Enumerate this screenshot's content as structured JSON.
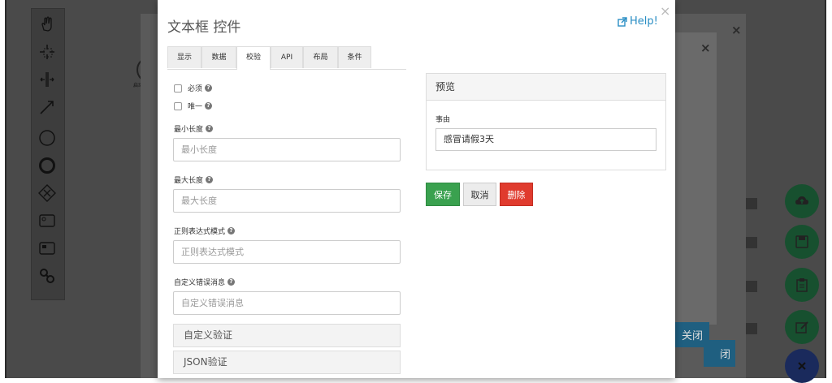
{
  "dialog": {
    "title": "文本框 控件",
    "help_label": "Help!",
    "close_glyph": "×"
  },
  "tabs": [
    {
      "label": "显示"
    },
    {
      "label": "数据"
    },
    {
      "label": "校验"
    },
    {
      "label": "API"
    },
    {
      "label": "布局"
    },
    {
      "label": "条件"
    }
  ],
  "active_tab": "校验",
  "validation": {
    "required_label": "必须",
    "unique_label": "唯一",
    "min_length": {
      "label": "最小长度",
      "placeholder": "最小长度"
    },
    "max_length": {
      "label": "最大长度",
      "placeholder": "最大长度"
    },
    "regex": {
      "label": "正则表达式模式",
      "placeholder": "正则表达式模式"
    },
    "custom_error": {
      "label": "自定义错误消息",
      "placeholder": "自定义错误消息"
    },
    "custom_validation_label": "自定义验证",
    "json_validation_label": "JSON验证",
    "help_glyph": "?"
  },
  "preview": {
    "heading": "预览",
    "field_label": "事由",
    "field_value": "感冒请假3天"
  },
  "actions": {
    "save": "保存",
    "cancel": "取消",
    "delete": "删除"
  },
  "background": {
    "close_glyph": "×",
    "close_button": "关闭",
    "partial_button": "闭",
    "canvas_text": "启动"
  },
  "colors": {
    "save": "#3aa14f",
    "delete": "#e03b2e",
    "help_link": "#2a8ec4"
  }
}
